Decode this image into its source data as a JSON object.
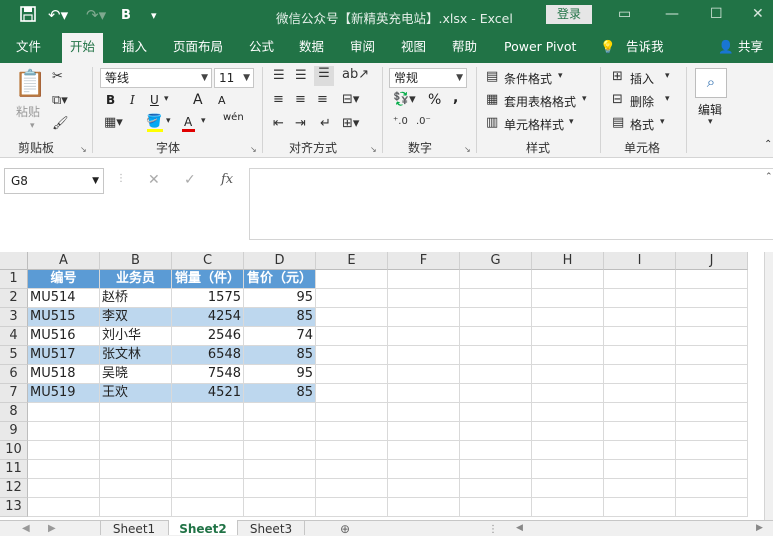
{
  "window": {
    "title": "微信公众号【新精英充电站】.xlsx - Excel",
    "login_label": "登录",
    "redo_icon": "redo-icon",
    "bold_label": "B"
  },
  "tabs": [
    {
      "label": "文件"
    },
    {
      "label": "开始"
    },
    {
      "label": "插入"
    },
    {
      "label": "页面布局"
    },
    {
      "label": "公式"
    },
    {
      "label": "数据"
    },
    {
      "label": "审阅"
    },
    {
      "label": "视图"
    },
    {
      "label": "帮助"
    },
    {
      "label": "Power Pivot"
    },
    {
      "label": "告诉我"
    },
    {
      "label": "共享"
    }
  ],
  "ribbon": {
    "clipboard": {
      "paste_label": "粘贴",
      "group_label": "剪贴板"
    },
    "font": {
      "font_name": "等线",
      "font_size": "11",
      "bold": "B",
      "italic": "I",
      "underline": "U",
      "grow": "A",
      "shrink": "A",
      "font_color": "A",
      "phonetic": "wén",
      "group_label": "字体"
    },
    "alignment": {
      "group_label": "对齐方式"
    },
    "number": {
      "format": "常规",
      "percent": "%",
      "comma": ",",
      "group_label": "数字"
    },
    "styles": {
      "conditional": "条件格式",
      "table": "套用表格格式",
      "cell_styles": "单元格样式",
      "group_label": "样式"
    },
    "cells": {
      "insert": "插入",
      "delete": "删除",
      "format": "格式",
      "group_label": "单元格"
    },
    "editing": {
      "label": "编辑"
    }
  },
  "formula_bar": {
    "name_box": "G8",
    "fx": "fx",
    "content": ""
  },
  "columns": [
    "A",
    "B",
    "C",
    "D",
    "E",
    "F",
    "G",
    "H",
    "I",
    "J"
  ],
  "rows": [
    "1",
    "2",
    "3",
    "4",
    "5",
    "6",
    "7",
    "8",
    "9",
    "10",
    "11",
    "12",
    "13"
  ],
  "table": {
    "header": [
      "编号",
      "业务员",
      "销量（件）",
      "售价（元）"
    ],
    "rows": [
      [
        "MU514",
        "赵桥",
        "1575",
        "95"
      ],
      [
        "MU515",
        "李双",
        "4254",
        "85"
      ],
      [
        "MU516",
        "刘小华",
        "2546",
        "74"
      ],
      [
        "MU517",
        "张文林",
        "6548",
        "85"
      ],
      [
        "MU518",
        "吴晓",
        "7548",
        "95"
      ],
      [
        "MU519",
        "王欢",
        "4521",
        "85"
      ]
    ]
  },
  "colors": {
    "accent": "#217346",
    "header_fill": "#5b9bd5",
    "band_fill": "#bdd7ee"
  },
  "sheets": [
    {
      "label": "Sheet1"
    },
    {
      "label": "Sheet2"
    },
    {
      "label": "Sheet3"
    }
  ],
  "active_sheet": "Sheet2"
}
